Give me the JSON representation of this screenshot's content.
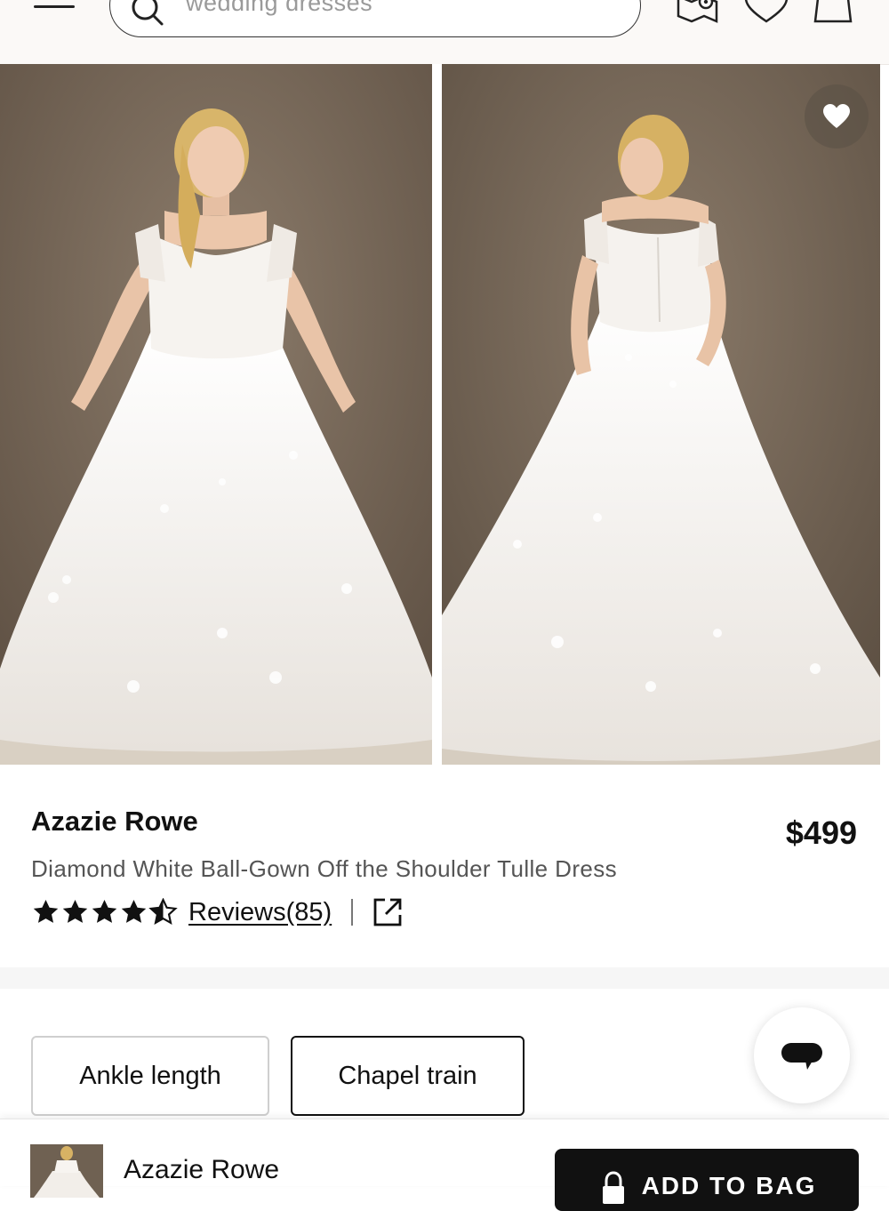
{
  "header": {
    "search_placeholder": "wedding dresses",
    "icons": [
      "menu-icon",
      "search-icon",
      "store-locator-icon",
      "heart-icon",
      "shopping-bag-icon"
    ]
  },
  "product": {
    "brand": "Azazie Rowe",
    "price": "$499",
    "name": "Diamond White Ball-Gown Off the Shoulder Tulle Dress",
    "rating": 4.5,
    "reviews_label": "Reviews(85)",
    "images": [
      "front-view",
      "back-view"
    ]
  },
  "length_options": [
    {
      "label": "Ankle length",
      "selected": false
    },
    {
      "label": "Chapel train",
      "selected": true
    }
  ],
  "bottom_bar": {
    "name": "Azazie Rowe",
    "add_to_bag": "ADD TO BAG"
  },
  "colors": {
    "background_photo": "#7d6d5d",
    "dress": "#f3f0ec",
    "primary_dark": "#111111"
  }
}
